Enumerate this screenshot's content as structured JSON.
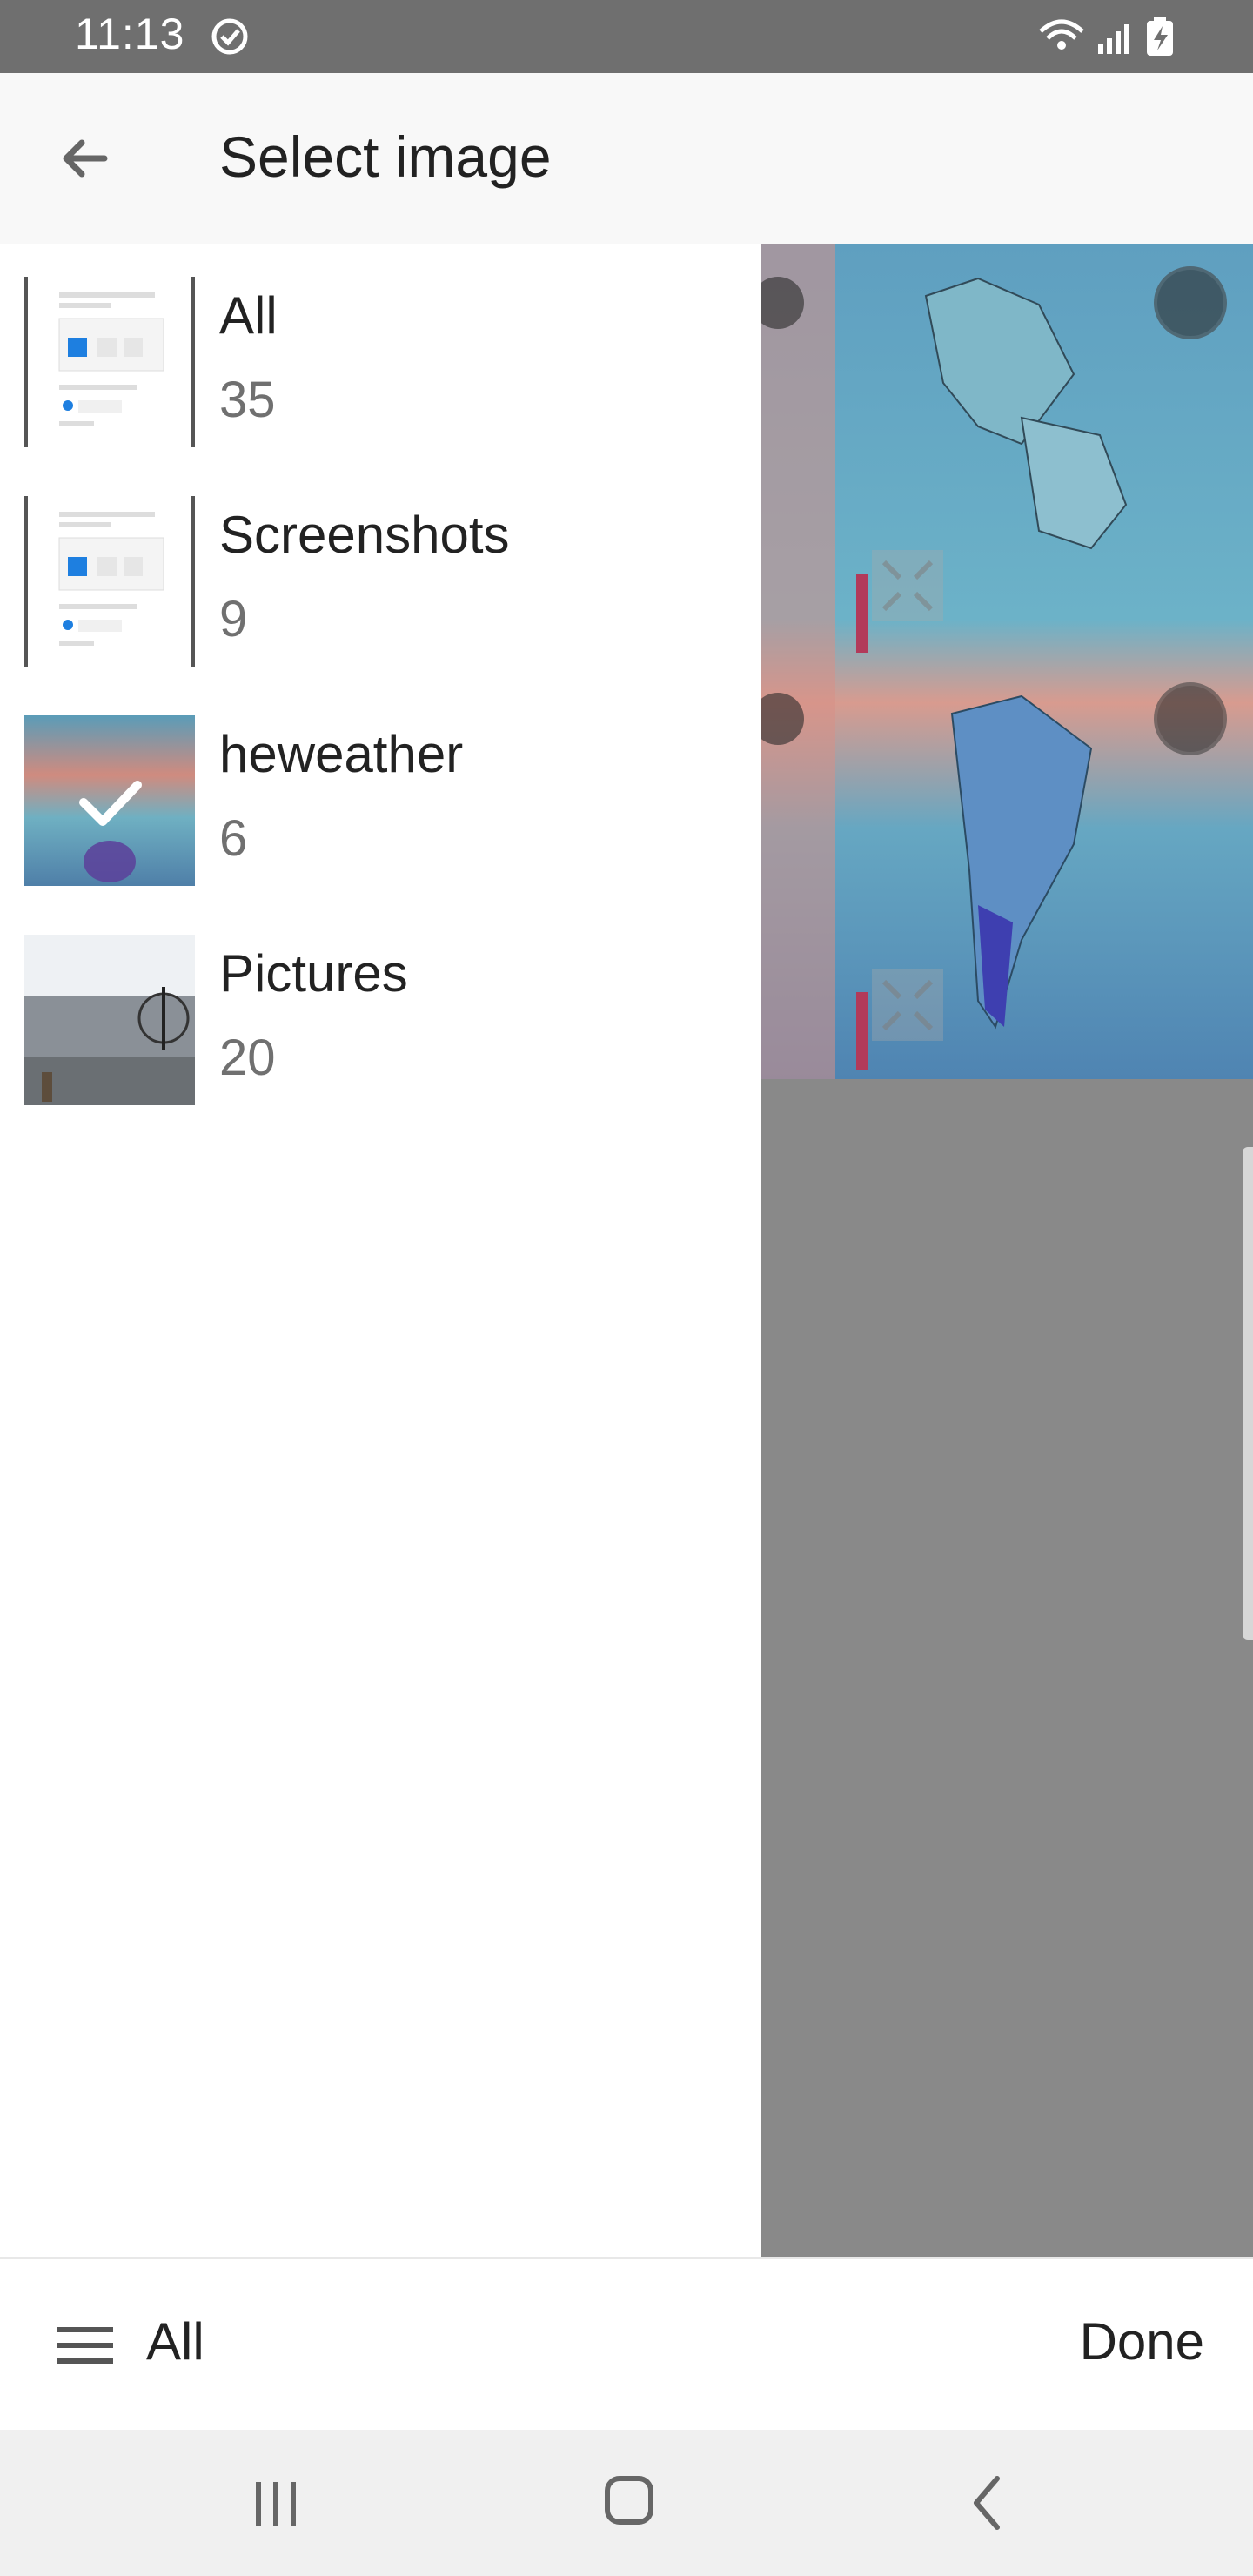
{
  "status_bar": {
    "time": "11:13"
  },
  "header": {
    "title": "Select image"
  },
  "albums": [
    {
      "name": "All",
      "count": "35"
    },
    {
      "name": "Screenshots",
      "count": "9"
    },
    {
      "name": "heweather",
      "count": "6"
    },
    {
      "name": "Pictures",
      "count": "20"
    }
  ],
  "bottom_bar": {
    "album_label": "All",
    "done_label": "Done"
  },
  "colors": {
    "status_bar": "#6f6f6f",
    "app_bar": "#f8f8f8",
    "preview_bg": "#898989",
    "nav_bar": "#f0f0f0"
  }
}
